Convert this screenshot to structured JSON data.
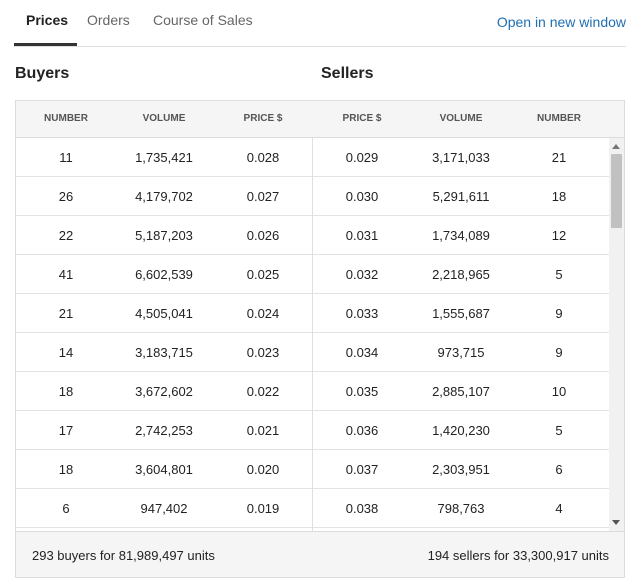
{
  "tabs": [
    {
      "label": "Prices",
      "active": true
    },
    {
      "label": "Orders",
      "active": false
    },
    {
      "label": "Course of Sales",
      "active": false
    }
  ],
  "open_link": "Open in new window",
  "buyers_title": "Buyers",
  "sellers_title": "Sellers",
  "columns": [
    "NUMBER",
    "VOLUME",
    "PRICE $",
    "PRICE $",
    "VOLUME",
    "NUMBER"
  ],
  "rows": [
    [
      "11",
      "1,735,421",
      "0.028",
      "0.029",
      "3,171,033",
      "21"
    ],
    [
      "26",
      "4,179,702",
      "0.027",
      "0.030",
      "5,291,611",
      "18"
    ],
    [
      "22",
      "5,187,203",
      "0.026",
      "0.031",
      "1,734,089",
      "12"
    ],
    [
      "41",
      "6,602,539",
      "0.025",
      "0.032",
      "2,218,965",
      "5"
    ],
    [
      "21",
      "4,505,041",
      "0.024",
      "0.033",
      "1,555,687",
      "9"
    ],
    [
      "14",
      "3,183,715",
      "0.023",
      "0.034",
      "973,715",
      "9"
    ],
    [
      "18",
      "3,672,602",
      "0.022",
      "0.035",
      "2,885,107",
      "10"
    ],
    [
      "17",
      "2,742,253",
      "0.021",
      "0.036",
      "1,420,230",
      "5"
    ],
    [
      "18",
      "3,604,801",
      "0.020",
      "0.037",
      "2,303,951",
      "6"
    ],
    [
      "6",
      "947,402",
      "0.019",
      "0.038",
      "798,763",
      "4"
    ]
  ],
  "footer": {
    "buyers_summary": "293 buyers for 81,989,497 units",
    "sellers_summary": "194 sellers for 33,300,917 units"
  },
  "icons": {
    "scroll_up": "chevron-up-icon",
    "scroll_down": "chevron-down-icon"
  },
  "colors": {
    "link": "#1f6fb2",
    "active_tab_underline": "#333333",
    "header_bg": "#f5f5f5"
  }
}
